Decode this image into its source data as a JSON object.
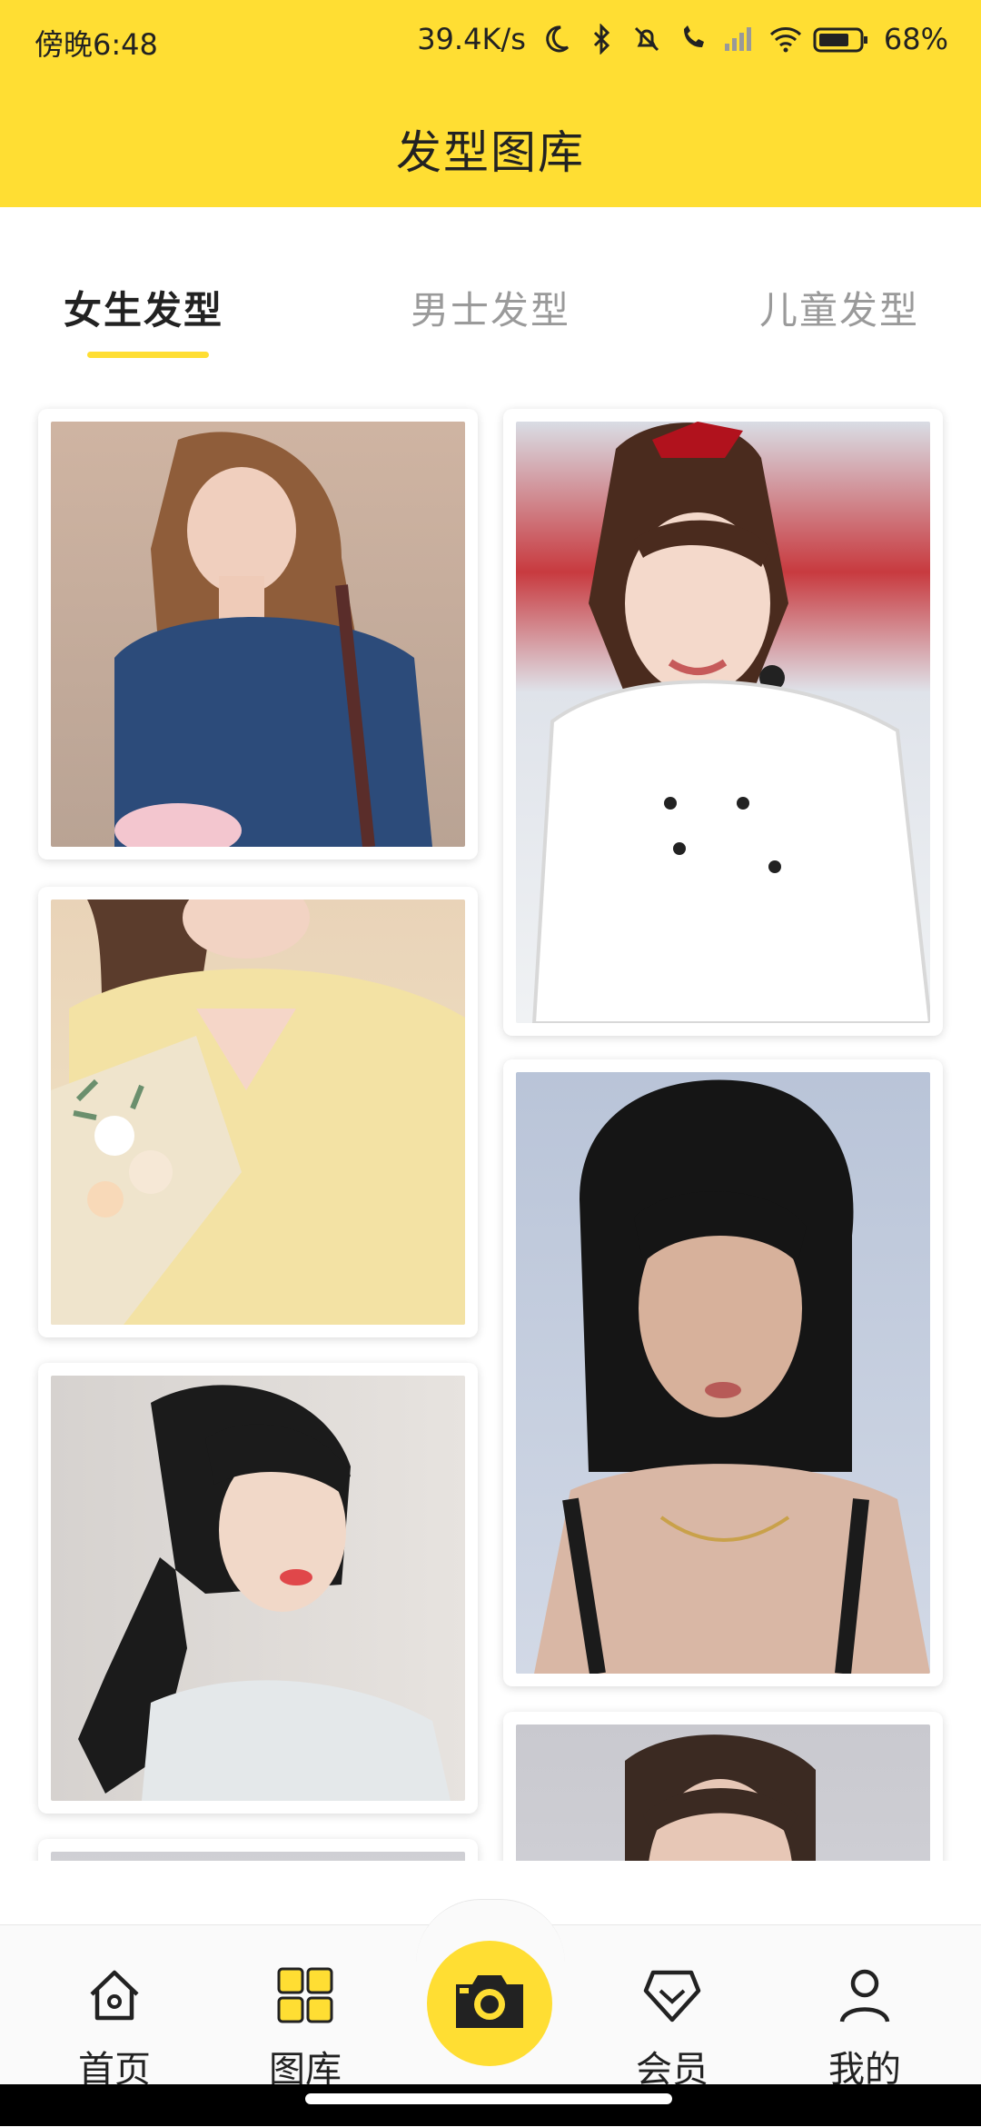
{
  "status_bar": {
    "time": "傍晚6:48",
    "network_speed": "39.4K/s",
    "battery": "68%"
  },
  "header": {
    "title": "发型图库"
  },
  "tabs": [
    {
      "label": "女生发型",
      "active": true
    },
    {
      "label": "男士发型",
      "active": false
    },
    {
      "label": "儿童发型",
      "active": false
    }
  ],
  "gallery": {
    "photos": [
      {
        "name": "photo-woman-brown-wavy-bob",
        "palette": [
          "#c9a58a",
          "#2c4b7a",
          "#8f5d3a"
        ]
      },
      {
        "name": "photo-woman-red-bow-ponytail",
        "palette": [
          "#d9dde5",
          "#ffffff",
          "#4a2b1e"
        ]
      },
      {
        "name": "photo-woman-yellow-sweater",
        "palette": [
          "#f3e2a4",
          "#5b3c2c",
          "#efe4cc"
        ]
      },
      {
        "name": "photo-woman-black-bob",
        "palette": [
          "#b9c4d8",
          "#151515",
          "#d7b19b"
        ]
      },
      {
        "name": "photo-woman-black-ponytail-bangs",
        "palette": [
          "#d6d2cf",
          "#1b1b1b",
          "#f1d8c8"
        ]
      },
      {
        "name": "photo-woman-partial",
        "palette": [
          "#c9c9cf",
          "#3b2a22",
          "#e7c7b6"
        ]
      },
      {
        "name": "photo-partial-bottom-left",
        "palette": [
          "#cfcfd4",
          "#3b2a22",
          "#e5ccbe"
        ]
      }
    ]
  },
  "nav": {
    "items": [
      {
        "label": "首页",
        "icon": "home-icon"
      },
      {
        "label": "图库",
        "icon": "grid-icon"
      },
      {
        "label": "",
        "icon": "camera-icon"
      },
      {
        "label": "会员",
        "icon": "vip-diamond-icon"
      },
      {
        "label": "我的",
        "icon": "user-icon"
      }
    ]
  },
  "colors": {
    "accent": "#FFDE33",
    "text_primary": "#222222",
    "text_secondary": "#9a9a9a"
  }
}
